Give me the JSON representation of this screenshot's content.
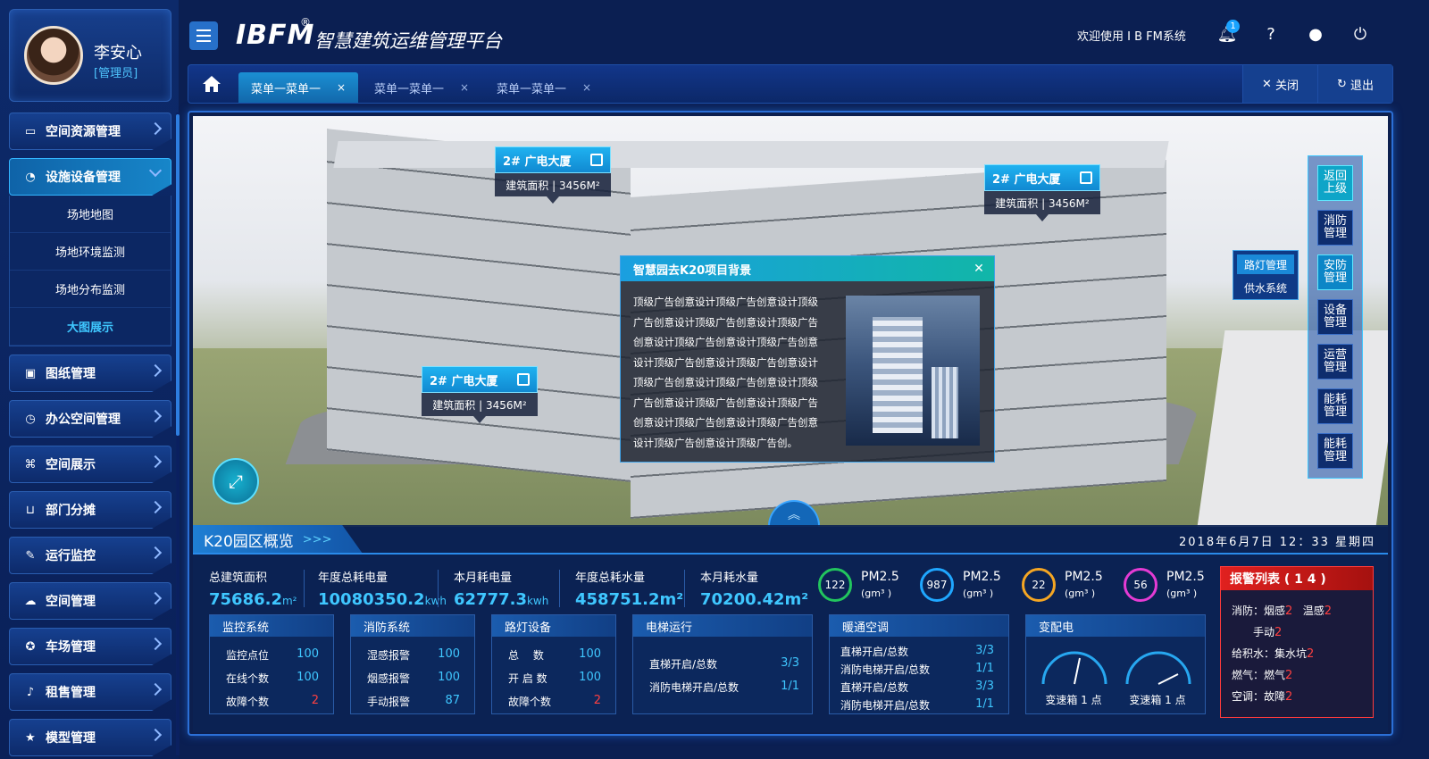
{
  "user": {
    "name": "李安心",
    "role": "[管理员]"
  },
  "header": {
    "logo": "IBFM",
    "logo_reg": "®",
    "platform_title": "智慧建筑运维管理平台",
    "welcome": "欢迎使用 I B FM系统",
    "notify_count": "1",
    "icons": [
      "bell-icon",
      "help-icon",
      "user-icon",
      "power-icon"
    ]
  },
  "sidebar": {
    "items": [
      {
        "label": "空间资源管理",
        "icon": "monitor-icon"
      },
      {
        "label": "设施设备管理",
        "icon": "pie-icon",
        "active": true,
        "children": [
          "场地地图",
          "场地环境监测",
          "场地分布监测",
          "大图展示"
        ],
        "active_child": "大图展示"
      },
      {
        "label": "图纸管理",
        "icon": "image-icon"
      },
      {
        "label": "办公空间管理",
        "icon": "clock-icon"
      },
      {
        "label": "空间展示",
        "icon": "command-icon"
      },
      {
        "label": "部门分摊",
        "icon": "basket-icon"
      },
      {
        "label": "运行监控",
        "icon": "wrench-icon"
      },
      {
        "label": "空间管理",
        "icon": "cloud-icon"
      },
      {
        "label": "车场管理",
        "icon": "car-icon"
      },
      {
        "label": "租售管理",
        "icon": "mic-icon"
      },
      {
        "label": "模型管理",
        "icon": "star-icon"
      }
    ]
  },
  "tabs": {
    "items": [
      "菜单一菜单一",
      "菜单一菜单一",
      "菜单一菜单一"
    ],
    "close_glyph": "×",
    "close_label": "关闭",
    "logout_label": "退出"
  },
  "scene": {
    "tags": [
      {
        "title": "2# 广电大厦",
        "area": "建筑面积 | 3456M²"
      },
      {
        "title": "2# 广电大厦",
        "area": "建筑面积 | 3456M²"
      },
      {
        "title": "2# 广电大厦",
        "area": "建筑面积 | 3456M²"
      }
    ],
    "info_popup": {
      "title": "智慧园去K20项目背景",
      "text": "顶级广告创意设计顶级广告创意设计顶级广告创意设计顶级广告创意设计顶级广告创意设计顶级广告创意设计顶级广告创意设计顶级广告创意设计顶级广告创意设计顶级广告创意设计顶级广告创意设计顶级广告创意设计顶级广告创意设计顶级广告创意设计顶级广告创意设计顶级广告创意设计顶级广告创意设计顶级广告创。"
    },
    "right_panel": [
      "返回上级",
      "消防管理",
      "安防管理",
      "设备管理",
      "运营管理",
      "能耗管理",
      "能耗管理"
    ],
    "side_popup": [
      "路灯管理",
      "供水系统"
    ]
  },
  "overview": {
    "title": "K20园区概览",
    "datetime": "2018年6月7日 12：33 星期四",
    "stats": [
      {
        "label": "总建筑面积",
        "value": "75686.2",
        "unit": "m²"
      },
      {
        "label": "年度总耗电量",
        "value": "10080350.2",
        "unit": "kwh"
      },
      {
        "label": "本月耗电量",
        "value": "62777.3",
        "unit": "kwh"
      },
      {
        "label": "年度总耗水量",
        "value": "458751.2m²",
        "unit": ""
      },
      {
        "label": "本月耗水量",
        "value": "70200.42m²",
        "unit": ""
      }
    ],
    "pm": [
      {
        "value": "122",
        "label": "PM2.5",
        "unit": "(gm³ )",
        "color": "#22c55e"
      },
      {
        "value": "987",
        "label": "PM2.5",
        "unit": "(gm³ )",
        "color": "#1fa7ff"
      },
      {
        "value": "22",
        "label": "PM2.5",
        "unit": "(gm³ )",
        "color": "#f5a623"
      },
      {
        "value": "56",
        "label": "PM2.5",
        "unit": "(gm³ )",
        "color": "#e53bd4"
      }
    ],
    "alarm": {
      "title": "报警列表 ( 1 4 )",
      "rows": [
        {
          "a": "消防：烟感",
          "an": "2",
          "b": "温感",
          "bn": "2"
        },
        {
          "a": "手动",
          "an": "2"
        },
        {
          "a": "给积水：集水坑",
          "an": "2"
        },
        {
          "a": "燃气：燃气",
          "an": "2"
        },
        {
          "a": "空调：故障",
          "an": "2"
        }
      ]
    },
    "boxes": {
      "monitor": {
        "title": "监控系统",
        "rows": [
          [
            "监控点位",
            "100"
          ],
          [
            "在线个数",
            "100"
          ],
          [
            "故障个数",
            "2"
          ]
        ]
      },
      "fire": {
        "title": "消防系统",
        "rows": [
          [
            "湿感报警",
            "100"
          ],
          [
            "烟感报警",
            "100"
          ],
          [
            "手动报警",
            "87"
          ]
        ]
      },
      "light": {
        "title": "路灯设备",
        "rows": [
          [
            "总　 数",
            "100"
          ],
          [
            "开 启 数",
            "100"
          ],
          [
            "故障个数",
            "2"
          ]
        ]
      },
      "elevator": {
        "title": "电梯运行",
        "rows": [
          [
            "直梯开启/总数",
            "3/3"
          ],
          [
            "消防电梯开启/总数",
            "1/1"
          ]
        ]
      },
      "hvac": {
        "title": "暖通空调",
        "rows": [
          [
            "直梯开启/总数",
            "3/3"
          ],
          [
            "消防电梯开启/总数",
            "1/1"
          ],
          [
            "直梯开启/总数",
            "3/3"
          ],
          [
            "消防电梯开启/总数",
            "1/1"
          ]
        ]
      },
      "power": {
        "title": "变配电",
        "dials": [
          "变速箱 1 点",
          "变速箱 1 点"
        ]
      }
    }
  }
}
